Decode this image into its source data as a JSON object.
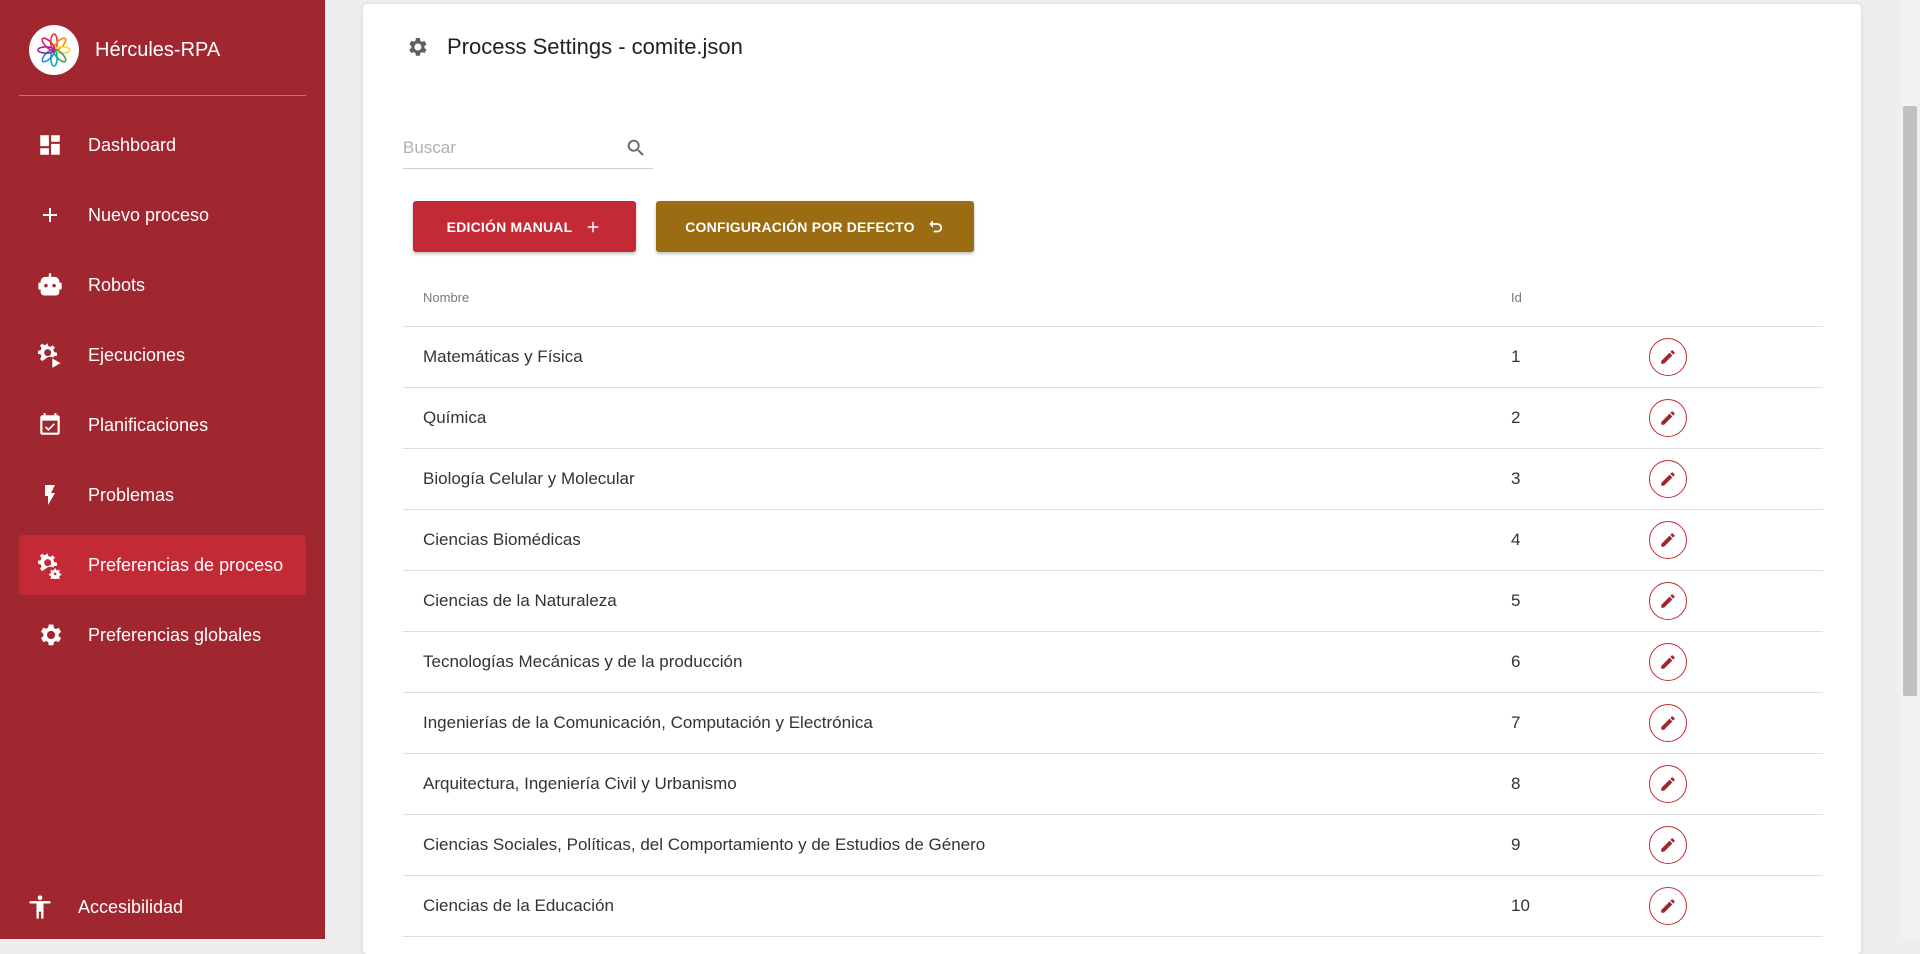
{
  "app": {
    "name": "Hércules-RPA"
  },
  "sidebar": {
    "items": [
      {
        "label": "Dashboard",
        "icon": "dashboard-icon"
      },
      {
        "label": "Nuevo proceso",
        "icon": "plus-icon"
      },
      {
        "label": "Robots",
        "icon": "robot-icon"
      },
      {
        "label": "Ejecuciones",
        "icon": "cog-play-icon"
      },
      {
        "label": "Planificaciones",
        "icon": "calendar-check-icon"
      },
      {
        "label": "Problemas",
        "icon": "bolt-icon"
      },
      {
        "label": "Preferencias de proceso",
        "icon": "cog-settings-icon",
        "active": true
      },
      {
        "label": "Preferencias globales",
        "icon": "gear-icon"
      }
    ],
    "accessibility": {
      "label": "Accesibilidad",
      "icon": "accessibility-icon"
    }
  },
  "page": {
    "title": "Process Settings - comite.json",
    "search": {
      "placeholder": "Buscar",
      "value": ""
    },
    "buttons": {
      "manual": "EDICIÓN MANUAL",
      "defaults": "CONFIGURACIÓN POR DEFECTO"
    }
  },
  "table": {
    "headers": {
      "name": "Nombre",
      "id": "Id"
    },
    "rows": [
      {
        "name": "Matemáticas y Física",
        "id": "1"
      },
      {
        "name": "Química",
        "id": "2"
      },
      {
        "name": "Biología Celular y Molecular",
        "id": "3"
      },
      {
        "name": "Ciencias Biomédicas",
        "id": "4"
      },
      {
        "name": "Ciencias de la Naturaleza",
        "id": "5"
      },
      {
        "name": "Tecnologías Mecánicas y de la producción",
        "id": "6"
      },
      {
        "name": "Ingenierías de la Comunicación, Computación y Electrónica",
        "id": "7"
      },
      {
        "name": "Arquitectura, Ingeniería Civil y Urbanismo",
        "id": "8"
      },
      {
        "name": "Ciencias Sociales, Políticas, del Comportamiento y de Estudios de Género",
        "id": "9"
      },
      {
        "name": "Ciencias de la Educación",
        "id": "10"
      }
    ]
  },
  "colors": {
    "sidebar": "#a0262f",
    "accent": "#c42a36",
    "gold": "#9c6c12"
  }
}
